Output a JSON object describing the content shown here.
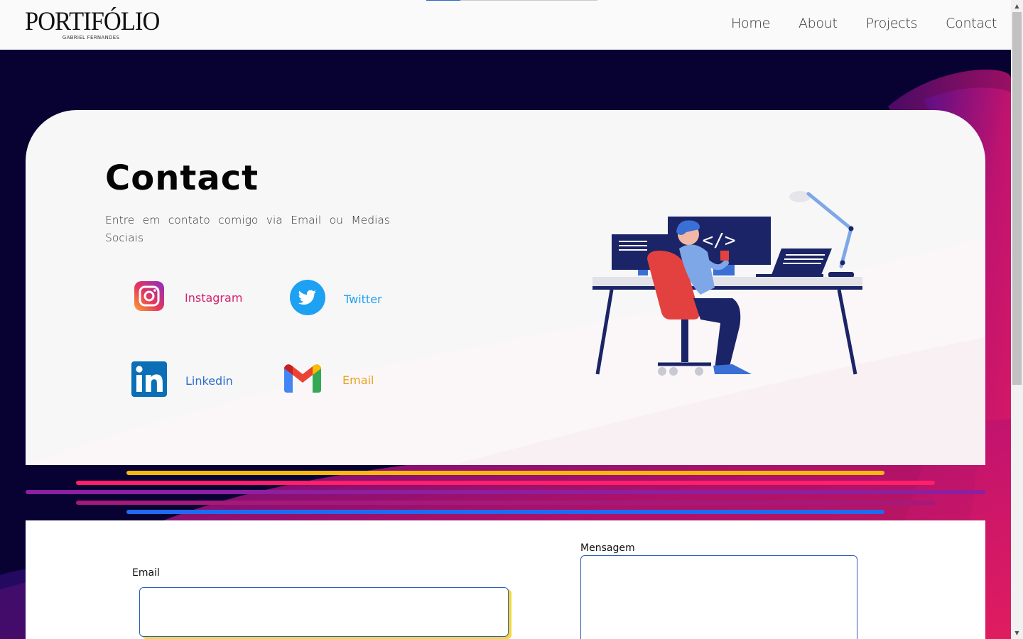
{
  "header": {
    "logo_title": "PORTIFÓLIO",
    "logo_subtitle": "GABRIEL FERNANDES",
    "nav": [
      {
        "label": "Home",
        "icon": ""
      },
      {
        "label": "About"
      },
      {
        "label": "Projects"
      },
      {
        "label": "Contact"
      }
    ],
    "scroll_progress": 0.2
  },
  "contact": {
    "title": "Contact",
    "description": "Entre em contato comigo via Email ou Medias Sociais",
    "socials": [
      {
        "label": "Instagram",
        "icon": "instagram-icon",
        "color": "#d4226f"
      },
      {
        "label": "Twitter",
        "icon": "twitter-icon",
        "color": "#1da1f2"
      },
      {
        "label": "Linkedin",
        "icon": "linkedin-icon",
        "color": "#2a6fc7"
      },
      {
        "label": "Email",
        "icon": "gmail-icon",
        "color": "#e8a21f"
      }
    ],
    "illustration": "developer-at-desk-illustration"
  },
  "form": {
    "email_label": "Email",
    "email_value": "",
    "message_label": "Mensagem",
    "message_value": ""
  },
  "colors": {
    "background": "#080233",
    "accent_magenta": "#d6176f",
    "stripe_yellow": "#f6b711",
    "stripe_pink": "#ff1f6b",
    "stripe_purple": "#8d1fa0",
    "stripe_blue": "#1f6bf0",
    "input_border": "#2c5fb4"
  }
}
